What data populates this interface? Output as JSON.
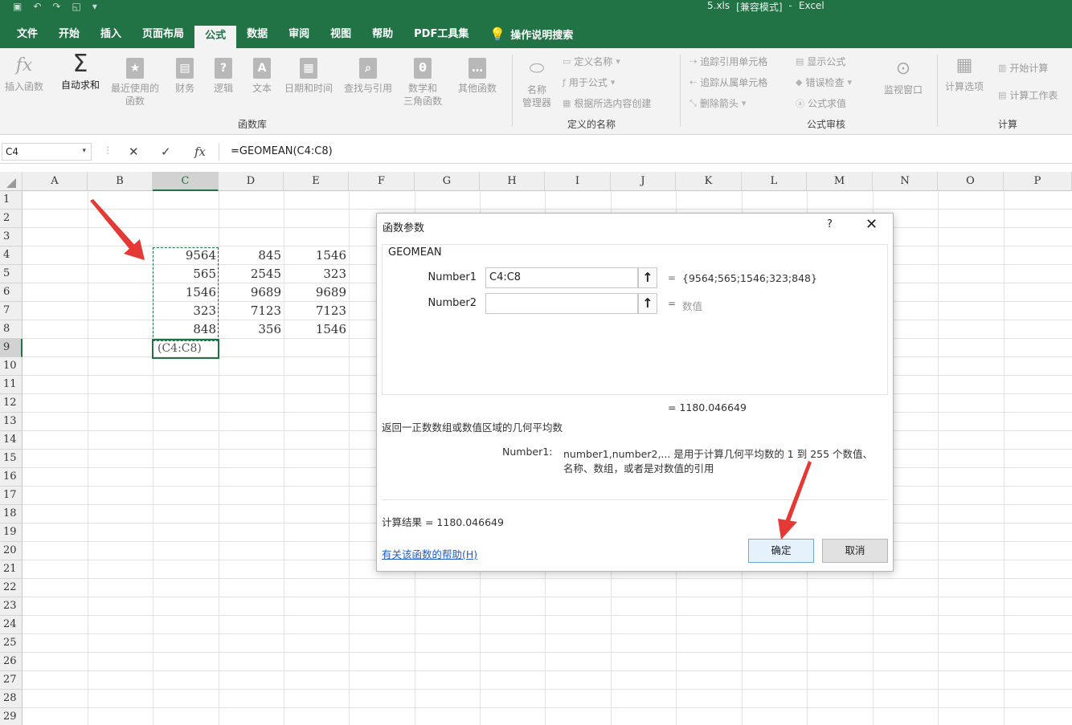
{
  "titlebar": {
    "filename": "5.xls",
    "mode": "[兼容模式]",
    "app": "Excel"
  },
  "tabs": [
    "文件",
    "开始",
    "插入",
    "页面布局",
    "公式",
    "数据",
    "审阅",
    "视图",
    "帮助",
    "PDF工具集"
  ],
  "active_tab": "公式",
  "tell_me": "操作说明搜索",
  "ribbon": {
    "insert_fn": "插入函数",
    "autosum": "自动求和",
    "recent_1": "最近使用的",
    "recent_2": "函数",
    "financial": "财务",
    "logical": "逻辑",
    "text": "文本",
    "datetime": "日期和时间",
    "lookup": "查找与引用",
    "math_1": "数学和",
    "math_2": "三角函数",
    "more": "其他函数",
    "group_library": "函数库",
    "name_mgr_1": "名称",
    "name_mgr_2": "管理器",
    "define_name": "定义名称",
    "use_in_formula": "用于公式",
    "create_from_sel": "根据所选内容创建",
    "group_names": "定义的名称",
    "trace_precedents": "追踪引用单元格",
    "trace_dependents": "追踪从属单元格",
    "remove_arrows": "删除箭头",
    "show_formulas": "显示公式",
    "error_check": "错误检查",
    "evaluate": "公式求值",
    "watch": "监视窗口",
    "group_audit": "公式审核",
    "calc_options": "计算选项",
    "calc_now": "开始计算",
    "calc_sheet": "计算工作表",
    "group_calc": "计算"
  },
  "formula_bar": {
    "name_box": "C4",
    "fx": "fx",
    "formula": "=GEOMEAN(C4:C8)"
  },
  "columns": [
    "A",
    "B",
    "C",
    "D",
    "E",
    "F",
    "G",
    "H",
    "I",
    "J",
    "K",
    "L",
    "M",
    "N",
    "O",
    "P"
  ],
  "rows": [
    "1",
    "2",
    "3",
    "4",
    "5",
    "6",
    "7",
    "8",
    "9",
    "10",
    "11",
    "12",
    "13",
    "14",
    "15",
    "16",
    "17",
    "18",
    "19",
    "20",
    "21",
    "22",
    "23",
    "24",
    "25",
    "26",
    "27",
    "28",
    "29"
  ],
  "cells": {
    "C": [
      "9564",
      "565",
      "1546",
      "323",
      "848"
    ],
    "D": [
      "845",
      "2545",
      "9689",
      "7123",
      "356"
    ],
    "E": [
      "1546",
      "323",
      "9689",
      "7123",
      "1546"
    ],
    "C9": "(C4:C8)"
  },
  "dialog": {
    "title": "函数参数",
    "help": "?",
    "close": "✕",
    "fn_name": "GEOMEAN",
    "arg1_label": "Number1",
    "arg1_value": "C4:C8",
    "arg1_eval": "{9564;565;1546;323;848}",
    "arg2_label": "Number2",
    "arg2_eval": "数值",
    "result_line": "= 1180.046649",
    "description": "返回一正数数组或数值区域的几何平均数",
    "arg_help_label": "Number1:",
    "arg_help_1": "number1,number2,... 是用于计算几何平均数的 1 到 255 个数值、",
    "arg_help_2": "名称、数组，或者是对数值的引用",
    "calc_result": "计算结果 =  1180.046649",
    "help_link": "有关该函数的帮助(H)",
    "ok": "确定",
    "cancel": "取消"
  }
}
